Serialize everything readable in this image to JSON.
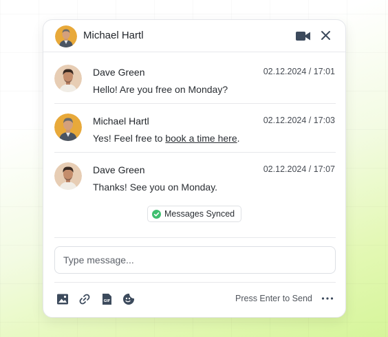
{
  "header": {
    "name": "Michael Hartl",
    "video_icon": "video-camera-icon",
    "close_icon": "close-icon"
  },
  "messages": [
    {
      "name": "Dave Green",
      "time": "02.12.2024 / 17:01",
      "text": "Hello! Are you free on Monday?"
    },
    {
      "name": "Michael Hartl",
      "time": "02.12.2024 / 17:03",
      "text_before": "Yes! Feel free to ",
      "link": "book a time here",
      "text_after": "."
    },
    {
      "name": "Dave Green",
      "time": "02.12.2024 / 17:07",
      "text": "Thanks! See you on Monday."
    }
  ],
  "sync": {
    "label": "Messages Synced",
    "icon": "check-circle-icon",
    "color": "#3fbf6f"
  },
  "composer": {
    "placeholder": "Type message...",
    "tools": [
      "image-icon",
      "link-icon",
      "gif-icon",
      "sticker-icon"
    ],
    "send_hint": "Press Enter to Send",
    "more_icon": "more-horizontal-icon"
  },
  "colors": {
    "accent_dark": "#3c4a5c",
    "michael_avatar_bg": "#e8a93a",
    "dave_avatar_bg": "#e7cdb4"
  }
}
